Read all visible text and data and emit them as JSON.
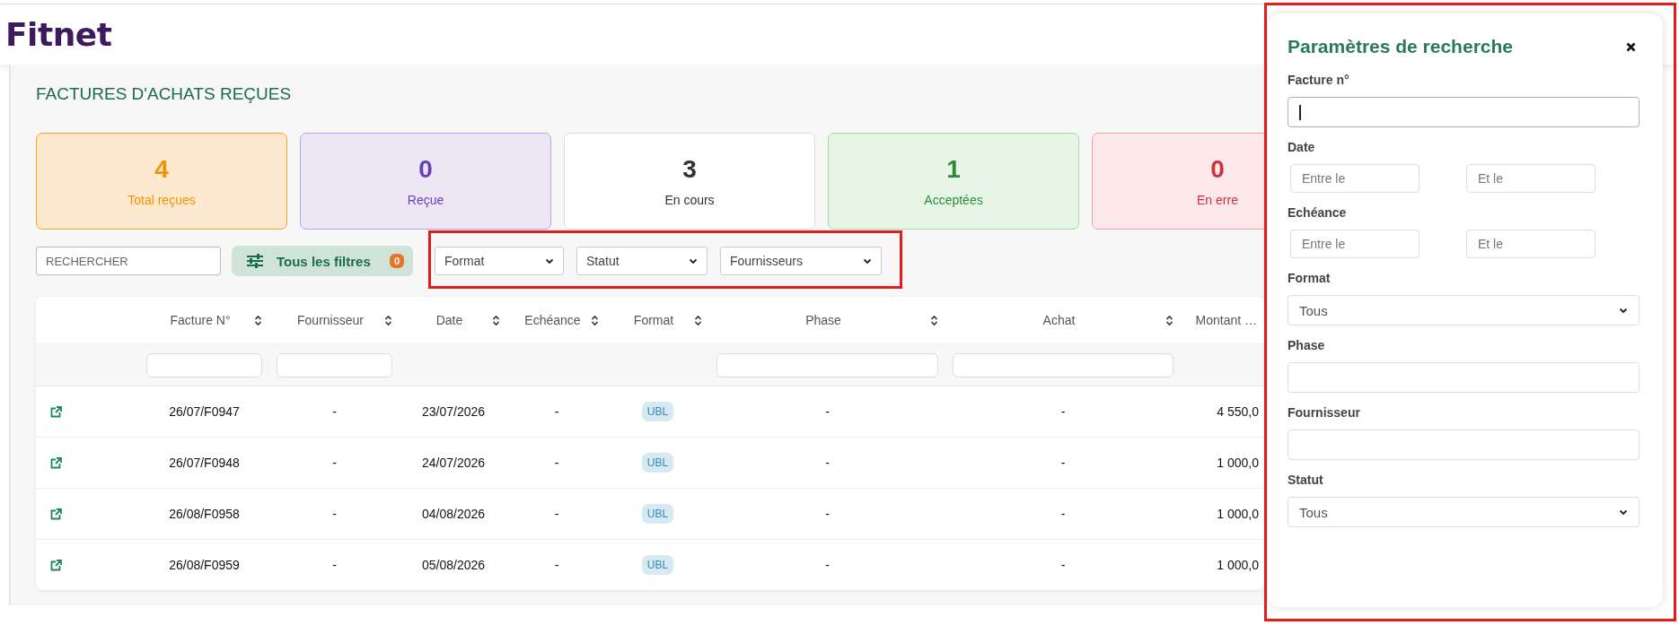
{
  "header": {
    "logo": "Fitnet"
  },
  "page_title": "FACTURES D'ACHATS REÇUES",
  "stats": [
    {
      "kind": "total",
      "value": "4",
      "label": "Total reçues"
    },
    {
      "kind": "received",
      "value": "0",
      "label": "Reçue"
    },
    {
      "kind": "in_progress",
      "value": "3",
      "label": "En cours"
    },
    {
      "kind": "accepted",
      "value": "1",
      "label": "Acceptées"
    },
    {
      "kind": "error",
      "value": "0",
      "label": "En erre"
    }
  ],
  "filters": {
    "search": {
      "placeholder": "RECHERCHER"
    },
    "all_filters": {
      "label": "Tous les filtres",
      "count": "0"
    },
    "selects": [
      "Format",
      "Statut",
      "Fournisseurs"
    ]
  },
  "table": {
    "columns": [
      {
        "label": "Facture N°",
        "sortable": true,
        "filter": true
      },
      {
        "label": "Fournisseur",
        "sortable": true,
        "filter": true
      },
      {
        "label": "Date",
        "sortable": true,
        "filter": false
      },
      {
        "label": "Echéance",
        "sortable": true,
        "filter": false
      },
      {
        "label": "Format",
        "sortable": true,
        "filter": false
      },
      {
        "label": "Phase",
        "sortable": true,
        "filter": true
      },
      {
        "label": "Achat",
        "sortable": true,
        "filter": true
      },
      {
        "label": "Montant …",
        "sortable": false,
        "filter": false
      }
    ],
    "rows": [
      [
        "26/07/F0947",
        "-",
        "23/07/2026",
        "-",
        "UBL",
        "-",
        "-",
        "4 550,0"
      ],
      [
        "26/07/F0948",
        "-",
        "24/07/2026",
        "-",
        "UBL",
        "-",
        "-",
        "1 000,0"
      ],
      [
        "26/08/F0958",
        "-",
        "04/08/2026",
        "-",
        "UBL",
        "-",
        "-",
        "1 000,0"
      ],
      [
        "26/08/F0959",
        "-",
        "05/08/2026",
        "-",
        "UBL",
        "-",
        "-",
        "1 000,0"
      ]
    ]
  },
  "search_panel": {
    "title": "Paramètres de recherche",
    "fields": [
      {
        "label": "Facture n°",
        "kind": "text",
        "focused": true
      },
      {
        "label": "Date",
        "kind": "range",
        "placeholders": [
          "Entre le",
          "Et le"
        ]
      },
      {
        "label": "Echéance",
        "kind": "range",
        "placeholders": [
          "Entre le",
          "Et le"
        ]
      },
      {
        "label": "Format",
        "kind": "select",
        "value": "Tous"
      },
      {
        "label": "Phase",
        "kind": "text",
        "focused": false
      },
      {
        "label": "Fournisseur",
        "kind": "text",
        "focused": false
      },
      {
        "label": "Statut",
        "kind": "select",
        "value": "Tous"
      }
    ]
  }
}
